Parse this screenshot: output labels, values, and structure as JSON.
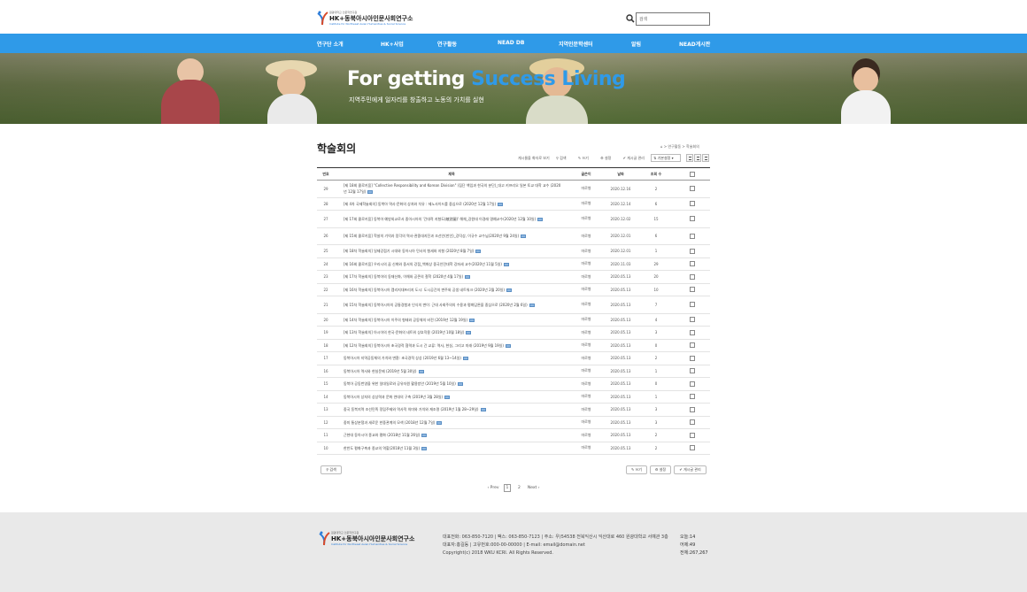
{
  "header": {
    "logo_small": "원광대학교 인문학연구원",
    "logo_main": "HK+동북아시아인문사회연구소",
    "logo_en": "Institute for Northeast Asian Humanities & Social Science",
    "search_placeholder": "검색"
  },
  "nav": [
    "연구단 소개",
    "HK+사업",
    "연구활동",
    "NEAD DB",
    "지역인문학센터",
    "알림",
    "NEAD게시판"
  ],
  "hero": {
    "title_prefix": "For getting ",
    "title_accent": "Success Living",
    "subtitle": "지역주민에게 일자리를 창출하고 노동의 가치를 실현"
  },
  "page": {
    "title": "학술회의",
    "breadcrumb": "⌂ > 연구활동 > 학술회의"
  },
  "tools": {
    "my_posts": "게시물을 화자로 보기",
    "search": "검색",
    "write": "쓰기",
    "settings": "설정",
    "manage": "게시글 관리",
    "sort": "기본설정"
  },
  "table": {
    "headers": [
      "번호",
      "제목",
      "글쓴이",
      "날짜",
      "조회 수",
      ""
    ],
    "rows": [
      {
        "no": "29",
        "title": "[제 18회 콜로키움] \"Collective Responsibility and Korean Division\" (집단 책임과 한국의 분단)_대고 키프리오 일본 토교 대학 교수 (2020년 12월 17일)",
        "author": "마로병",
        "date": "2020.12.16",
        "views": "2"
      },
      {
        "no": "28",
        "title": "[제 4차 국제학술회의] 동북아 역사·문화의 상처와 치유 : 제노사이드를 중심으로 (2020년 12월 17일)",
        "author": "마로병",
        "date": "2020.12.14",
        "views": "6"
      },
      {
        "no": "27",
        "title": "[제 17회 콜로키움] 동북아 예방외교로서 중아시아의 '긴대적 지형도(敵對圖)' 해체_강원대 이경래 명예교수(2020년 12월 10일)",
        "author": "마로병",
        "date": "2020.12.02",
        "views": "15"
      },
      {
        "no": "26",
        "title": "[제 15회 콜로키움] 학살의 기억과 망각의 역사-관중대지진과 조선인(한인)_강덕상, 이규수 교수님(2020년 9월 24일)",
        "author": "마로병",
        "date": "2020.12.01",
        "views": "6"
      },
      {
        "no": "25",
        "title": "[제 18차 학술회의] 일제강점기 시대와 동아시아 민사의 형세와 지형 (2020년 8월 7일)",
        "author": "마로병",
        "date": "2020.12.01",
        "views": "1"
      },
      {
        "no": "24",
        "title": "[제 16회 콜로키움] 우리시의 꿈 신화와 중서의 강점_백화상 중국인민대학 강좌세 교수(2020년 11월 5일)",
        "author": "마로병",
        "date": "2020.11.03",
        "views": "29"
      },
      {
        "no": "23",
        "title": "[제 17차 학술회의] 동북아의 동재신화, 이해와 공존의 철학 (2020년 4월 17일)",
        "author": "마로병",
        "date": "2020.05.13",
        "views": "20"
      },
      {
        "no": "22",
        "title": "[제 16차 학술회의] 동북아시아 캠리지대프리지 도시: 도시공간의 변주와 공생 네트워크 (2020년 2월 20일)",
        "author": "마로병",
        "date": "2020.05.13",
        "views": "10"
      },
      {
        "no": "21",
        "title": "[제 15차 학술회의] 동북아시아의 공통경험과 인식의 변이: 근대 사회주의의 수용과 평화담론을 중심으로 (2020년 2월 6일)",
        "author": "마로병",
        "date": "2020.05.13",
        "views": "7"
      },
      {
        "no": "20",
        "title": "[제 14차 학술회의] 동북아시아 이주의 형태와 공동체의 비전 (2019년 12월 19일)",
        "author": "마로병",
        "date": "2020.05.13",
        "views": "4"
      },
      {
        "no": "19",
        "title": "[제 13차 학술회의] 아시아의 한국·문화의 네트워 상호작용 (2019년 10월 18일)",
        "author": "마로병",
        "date": "2020.05.13",
        "views": "3"
      },
      {
        "no": "18",
        "title": "[제 12차 학술회의] 동북아시아 초국경적 협력과 도시 간 교류: 역사, 현실, 그리고 미래 (2019년 9월 19일)",
        "author": "마로병",
        "date": "2020.05.13",
        "views": "0"
      },
      {
        "no": "17",
        "title": "동북아시아 지역공동체의 가치와 변환: 초국경적 상상 (2019년 6월 13~14일)",
        "author": "마로병",
        "date": "2020.05.13",
        "views": "2"
      },
      {
        "no": "16",
        "title": "동북아시아 역사와 현실문제 (2019년 5월 30일)",
        "author": "마로병",
        "date": "2020.05.13",
        "views": "1"
      },
      {
        "no": "15",
        "title": "동북아 공동번영을 위한 일대일로와 공유자원 활용방안 (2019년 5월 10일)",
        "author": "마로병",
        "date": "2020.05.13",
        "views": "0"
      },
      {
        "no": "14",
        "title": "동북아시아 상처의 상상력과 문화 연대의 구축 (2019년 3월 28일)",
        "author": "마로병",
        "date": "2020.05.13",
        "views": "1"
      },
      {
        "no": "13",
        "title": "중국 동북지역 조선민족 정립주제와 역사적 의미와 가치와 재조명 (2019년 1월 28~29일)",
        "author": "마로병",
        "date": "2020.05.13",
        "views": "3"
      },
      {
        "no": "12",
        "title": "중미 통상분쟁과 새로운 한중관계의 모색 (2018년 12월 7일)",
        "author": "마로병",
        "date": "2020.05.13",
        "views": "3"
      },
      {
        "no": "11",
        "title": "근현대 동아시아 종교와 평화 (2018년 11월 26일)",
        "author": "마로병",
        "date": "2020.05.13",
        "views": "2"
      },
      {
        "no": "10",
        "title": "한반도 평화구축과 종교의 역할(2018년 11월 3일)",
        "author": "마로병",
        "date": "2020.05.13",
        "views": "2"
      }
    ]
  },
  "buttons": {
    "search": "검색",
    "write": "쓰기",
    "settings": "설정",
    "manage": "게시글 관리"
  },
  "pager": {
    "prev": "‹ Prev",
    "pages": [
      "1",
      "2"
    ],
    "next": "Next ›"
  },
  "footer": {
    "line1": "대표전화: 063-850-7120 | 팩스: 063-850-7123 | 주소: 우)54538 전북익산시 익산대로 460 원광대학교 서예관 3층",
    "line2": "대표자:홍길동 | 고유번호:000-00-00000 | E-mail: email@domain.net",
    "line3": "Copyright(c) 2018 WKU KCRI. All Rights Reserved.",
    "today": "오늘:14",
    "yesterday": "어제:49",
    "total": "전체:267,267"
  },
  "colors": {
    "brand_blue": "#2f9ae8",
    "footer_bg": "#e9e9e9"
  }
}
